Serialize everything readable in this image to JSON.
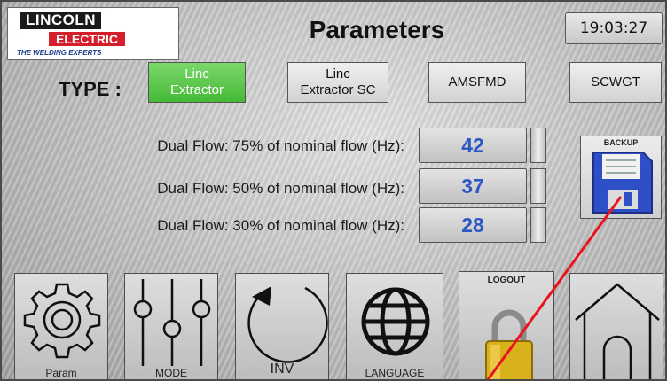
{
  "header": {
    "logo": {
      "brand": "LINCOLN",
      "sub": "ELECTRIC",
      "tagline": "THE WELDING EXPERTS"
    },
    "title": "Parameters",
    "clock": "19:03:27"
  },
  "type_row": {
    "label": "TYPE :",
    "options": [
      {
        "line1": "Linc",
        "line2": "Extractor",
        "selected": true
      },
      {
        "line1": "Linc",
        "line2": "Extractor SC",
        "selected": false
      },
      {
        "line1": "AMSFMD",
        "line2": "",
        "selected": false
      },
      {
        "line1": "SCWGT",
        "line2": "",
        "selected": false
      }
    ]
  },
  "parameters": [
    {
      "label": "Dual Flow: 75%  of nominal flow (Hz):",
      "value": "42"
    },
    {
      "label": "Dual Flow: 50%  of nominal flow (Hz):",
      "value": "37"
    },
    {
      "label": "Dual Flow: 30%  of nominal flow  (Hz):",
      "value": "28"
    }
  ],
  "backup": {
    "label": "BACKUP",
    "icon": "floppy-disk-icon"
  },
  "nav": {
    "param": {
      "label": "Param",
      "icon": "gear-icon"
    },
    "mode": {
      "label": "MODE",
      "icon": "sliders-icon"
    },
    "inv": {
      "label": "INV",
      "icon": "rotate-arrow-icon"
    },
    "language": {
      "label": "LANGUAGE",
      "icon": "globe-icon"
    },
    "logout": {
      "label": "LOGOUT",
      "icon": "padlock-icon"
    },
    "home": {
      "label": "",
      "icon": "home-icon"
    }
  },
  "colors": {
    "selected_type": "#45b936",
    "value_text": "#2d58c4",
    "brand_red": "#d51e2b",
    "pointer_line": "#e8141c",
    "floppy": "#2f4fc8",
    "lock": "#d9b11c"
  }
}
